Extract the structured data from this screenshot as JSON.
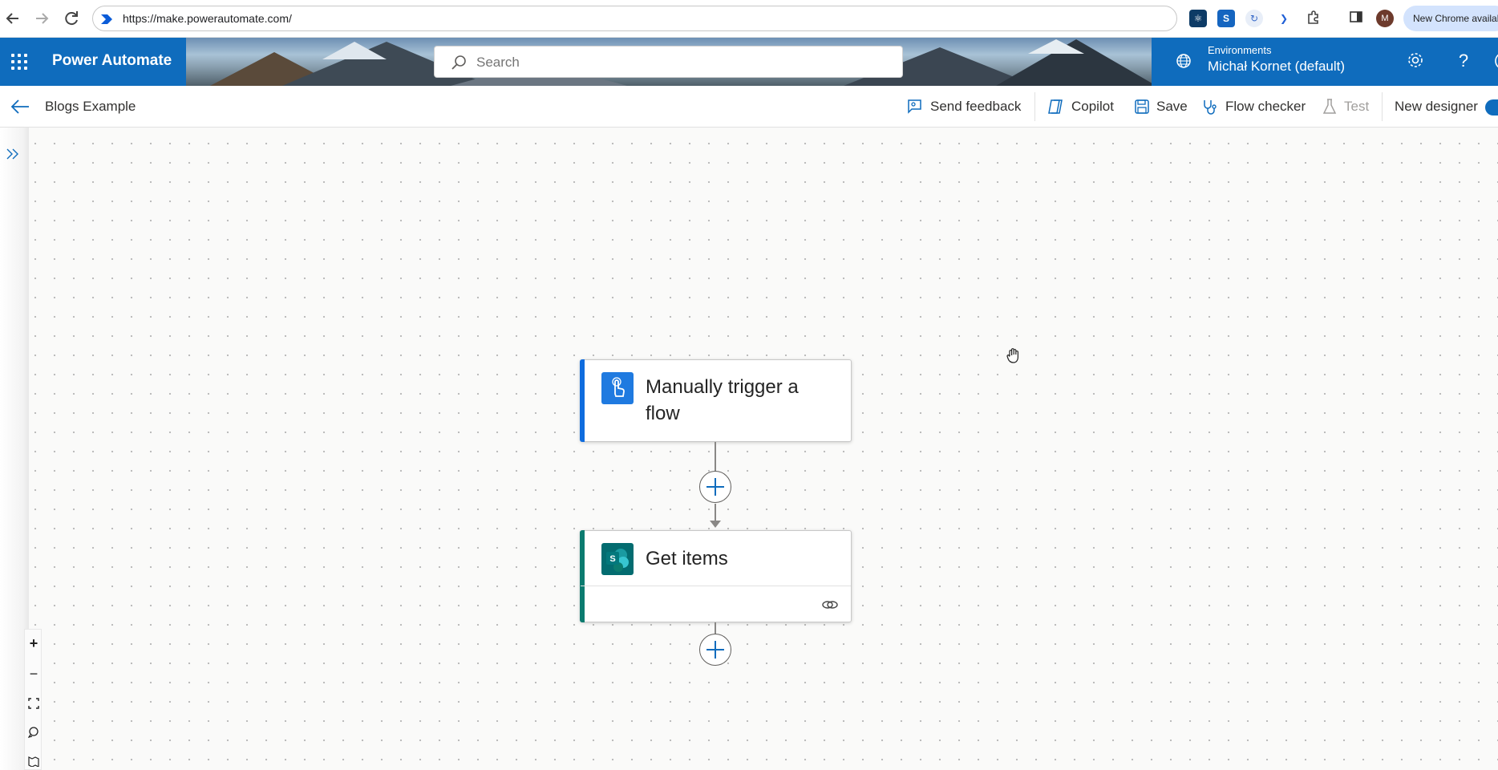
{
  "browser": {
    "url": "https://make.powerautomate.com/",
    "update_label": "New Chrome availab",
    "profile_initial": "M"
  },
  "header": {
    "app_title": "Power Automate",
    "search_placeholder": "Search",
    "env_label": "Environments",
    "env_name": "Michał Kornet (default)"
  },
  "command_bar": {
    "flow_name": "Blogs Example",
    "send_feedback": "Send feedback",
    "copilot": "Copilot",
    "save": "Save",
    "flow_checker": "Flow checker",
    "test": "Test",
    "new_designer": "New designer"
  },
  "canvas": {
    "nodes": [
      {
        "title_line1": "Manually trigger a",
        "title_line2": "flow",
        "accent": "#0f6cde",
        "icon": "touch-hand-icon",
        "icon_bg": "#1f7ae0"
      },
      {
        "title": "Get items",
        "accent": "#0b7b6f",
        "icon": "sharepoint-icon",
        "icon_bg": "#036c70"
      }
    ],
    "zoom_controls": [
      "zoom-in",
      "zoom-out",
      "fit-view",
      "comment",
      "map"
    ]
  },
  "colors": {
    "brand": "#0f6cbd",
    "trigger_accent": "#0f6cde",
    "action_accent": "#0b7b6f"
  }
}
